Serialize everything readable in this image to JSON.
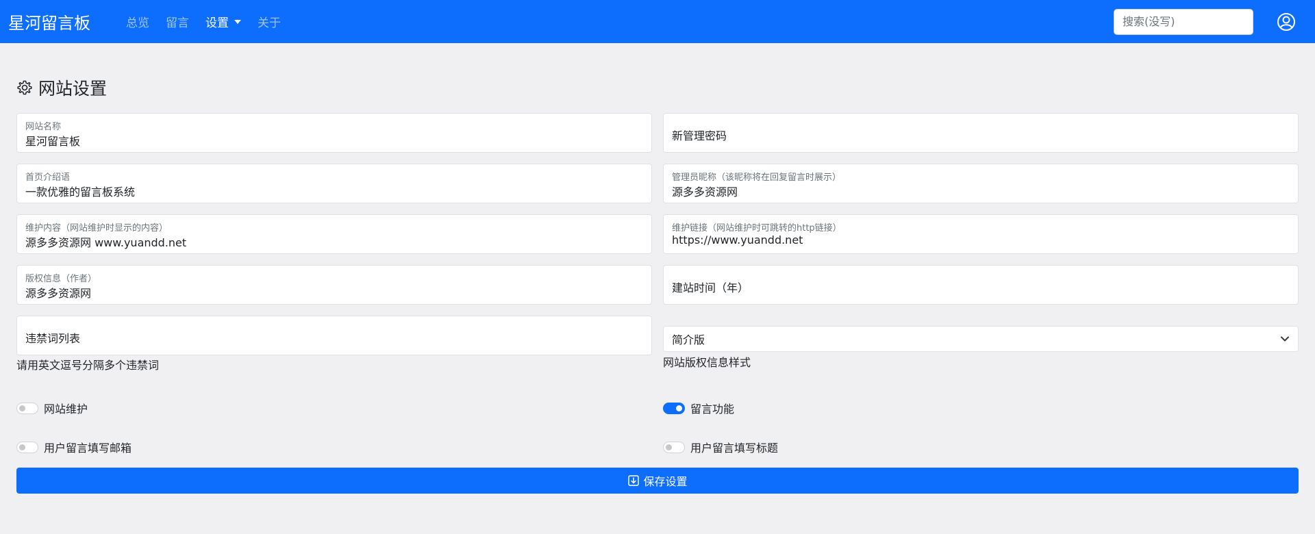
{
  "nav": {
    "brand": "星河留言板",
    "items": [
      {
        "label": "总览"
      },
      {
        "label": "留言"
      },
      {
        "label": "设置"
      },
      {
        "label": "关于"
      }
    ],
    "search_placeholder": "搜索(没写)",
    "user_icon": "person-circle-icon"
  },
  "page": {
    "title": "网站设置",
    "title_icon": "gear-icon"
  },
  "form": {
    "site_name": {
      "label": "网站名称",
      "value": "星河留言板"
    },
    "new_password": {
      "placeholder": "新管理密码"
    },
    "home_intro": {
      "label": "首页介绍语",
      "value": "一款优雅的留言板系统"
    },
    "admin_nick": {
      "label": "管理员昵称（该昵称将在回复留言时展示）",
      "value": "源多多资源网"
    },
    "maint_content": {
      "label": "维护内容（网站维护时显示的内容）",
      "value": "源多多资源网 www.yuandd.net"
    },
    "maint_link": {
      "label": "维护链接（网站维护时可跳转的http链接）",
      "value": "https://www.yuandd.net"
    },
    "copyright": {
      "label": "版权信息（作者）",
      "value": "源多多资源网"
    },
    "build_year": {
      "placeholder": "建站时间（年）"
    },
    "banned_words": {
      "placeholder": "违禁词列表",
      "help": "请用英文逗号分隔多个违禁词"
    },
    "copyright_style": {
      "selected": "简介版",
      "help": "网站版权信息样式"
    },
    "switches": {
      "maintenance": {
        "label": "网站维护",
        "on": false
      },
      "comments": {
        "label": "留言功能",
        "on": true
      },
      "require_email": {
        "label": "用户留言填写邮箱",
        "on": false
      },
      "require_title": {
        "label": "用户留言填写标题",
        "on": false
      }
    },
    "save_label": "保存设置",
    "save_icon": "download-icon"
  },
  "colors": {
    "primary": "#0d6efd",
    "background": "#f0f0f3"
  }
}
